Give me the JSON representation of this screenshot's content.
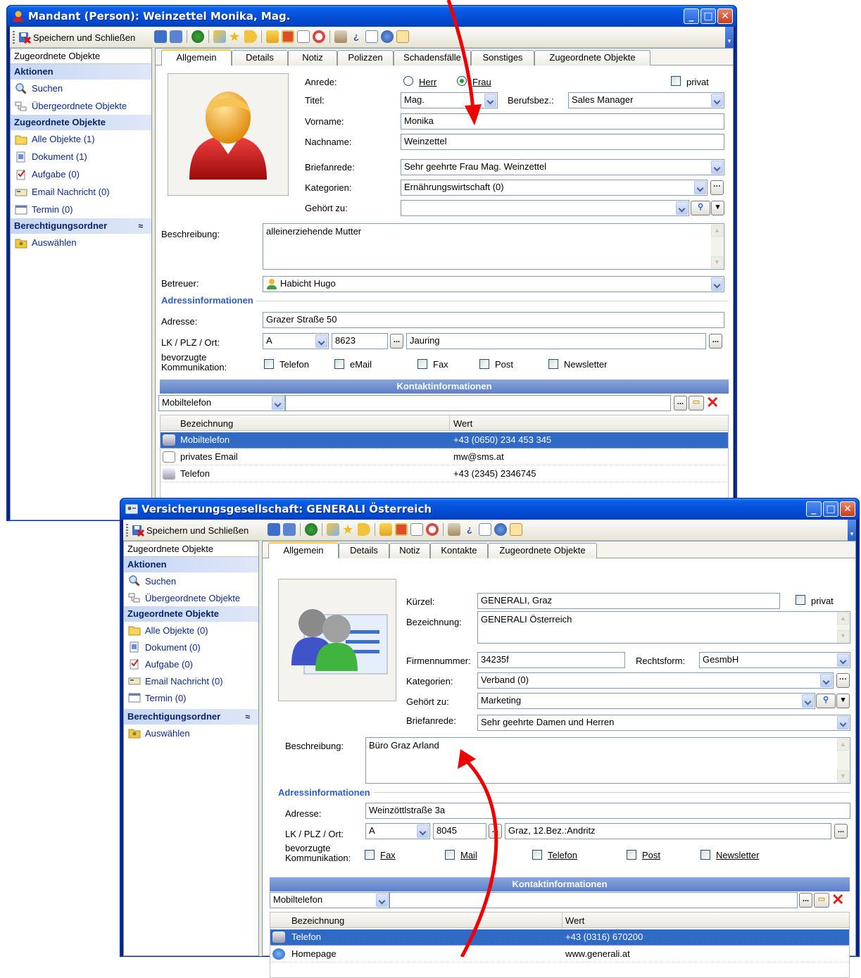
{
  "win1": {
    "title": "Mandant (Person): Weinzettel Monika, Mag.",
    "toolbar": {
      "save_close": "Speichern und Schließen"
    },
    "sidebar": {
      "header": "Zugeordnete Objekte",
      "actions_title": "Aktionen",
      "actions": [
        "Suchen",
        "Übergeordnete Objekte"
      ],
      "objects_title": "Zugeordnete Objekte",
      "objects": [
        "Alle Objekte (1)",
        "Dokument (1)",
        "Aufgabe (0)",
        "Email Nachricht (0)",
        "Termin (0)"
      ],
      "perm_title": "Berechtigungsordner",
      "perm_items": [
        "Auswählen"
      ]
    },
    "tabs": [
      "Allgemein",
      "Details",
      "Notiz",
      "Polizzen",
      "Schadensfälle",
      "Sonstiges",
      "Zugeordnete Objekte"
    ],
    "form": {
      "anrede_label": "Anrede:",
      "herr": "Herr",
      "frau": "Frau",
      "privat": "privat",
      "titel_label": "Titel:",
      "titel_value": "Mag.",
      "beruf_label": "Berufsbez.:",
      "beruf_value": "Sales Manager",
      "vorname_label": "Vorname:",
      "vorname_value": "Monika",
      "nachname_label": "Nachname:",
      "nachname_value": "Weinzettel",
      "briefanrede_label": "Briefanrede:",
      "briefanrede_value": "Sehr geehrte Frau Mag. Weinzettel",
      "kategorien_label": "Kategorien:",
      "kategorien_value": "Ernährungswirtschaft (0)",
      "gehoert_label": "Gehört zu:",
      "gehoert_value": "",
      "beschreibung_label": "Beschreibung:",
      "beschreibung_value": "alleinerziehende Mutter",
      "betreuer_label": "Betreuer:",
      "betreuer_value": "Habicht Hugo",
      "adress_title": "Adressinformationen",
      "adresse_label": "Adresse:",
      "adresse_value": "Grazer Straße 50",
      "lkplz_label": "LK / PLZ / Ort:",
      "lk_value": "A",
      "plz_value": "8623",
      "ort_value": "Jauring",
      "komm_label1": "bevorzugte",
      "komm_label2": "Kommunikation:",
      "komm_options": [
        "Telefon",
        "eMail",
        "Fax",
        "Post",
        "Newsletter"
      ]
    },
    "kontakt": {
      "title": "Kontaktinformationen",
      "type_value": "Mobiltelefon",
      "col_bezeichnung": "Bezeichnung",
      "col_wert": "Wert",
      "rows": [
        {
          "bezeichnung": "Mobiltelefon",
          "wert": "+43 (0650) 234 453 345"
        },
        {
          "bezeichnung": "privates Email",
          "wert": "mw@sms.at"
        },
        {
          "bezeichnung": "Telefon",
          "wert": "+43 (2345) 2346745"
        }
      ]
    }
  },
  "win2": {
    "title": "Versicherungsgesellschaft: GENERALI Österreich",
    "toolbar": {
      "save_close": "Speichern und Schließen"
    },
    "sidebar": {
      "header": "Zugeordnete Objekte",
      "actions_title": "Aktionen",
      "actions": [
        "Suchen",
        "Übergeordnete Objekte"
      ],
      "objects_title": "Zugeordnete Objekte",
      "objects": [
        "Alle Objekte (0)",
        "Dokument (0)",
        "Aufgabe (0)",
        "Email Nachricht (0)",
        "Termin (0)"
      ],
      "perm_title": "Berechtigungsordner",
      "perm_items": [
        "Auswählen"
      ]
    },
    "tabs": [
      "Allgemein",
      "Details",
      "Notiz",
      "Kontakte",
      "Zugeordnete Objekte"
    ],
    "form": {
      "kuerzel_label": "Kürzel:",
      "kuerzel_value": "GENERALI, Graz",
      "privat": "privat",
      "bezeichnung_label": "Bezeichnung:",
      "bezeichnung_value": "GENERALI Österreich",
      "firmennr_label": "Firmennummer:",
      "firmennr_value": "34235f",
      "rechtsform_label": "Rechtsform:",
      "rechtsform_value": "GesmbH",
      "kategorien_label": "Kategorien:",
      "kategorien_value": "Verband (0)",
      "gehoert_label": "Gehört zu:",
      "gehoert_value": "Marketing",
      "briefanrede_label": "Briefanrede:",
      "briefanrede_value": "Sehr geehrte Damen und Herren",
      "beschreibung_label": "Beschreibung:",
      "beschreibung_value": "Büro Graz Arland",
      "adress_title": "Adressinformationen",
      "adresse_label": "Adresse:",
      "adresse_value": "Weinzöttlstraße 3a",
      "lkplz_label": "LK / PLZ / Ort:",
      "lk_value": "A",
      "plz_value": "8045",
      "ort_value": "Graz, 12.Bez.:Andritz",
      "komm_label1": "bevorzugte",
      "komm_label2": "Kommunikation:",
      "komm_options": [
        "Fax",
        "Mail",
        "Telefon",
        "Post",
        "Newsletter"
      ]
    },
    "kontakt": {
      "title": "Kontaktinformationen",
      "type_value": "Mobiltelefon",
      "col_bezeichnung": "Bezeichnung",
      "col_wert": "Wert",
      "rows": [
        {
          "bezeichnung": "Telefon",
          "wert": "+43 (0316) 670200"
        },
        {
          "bezeichnung": "Homepage",
          "wert": "www.generali.at"
        }
      ]
    }
  },
  "colors": {
    "accent": "#316ac5",
    "annotation_arrow": "#ee0000",
    "title_blue": "#0550d9"
  }
}
